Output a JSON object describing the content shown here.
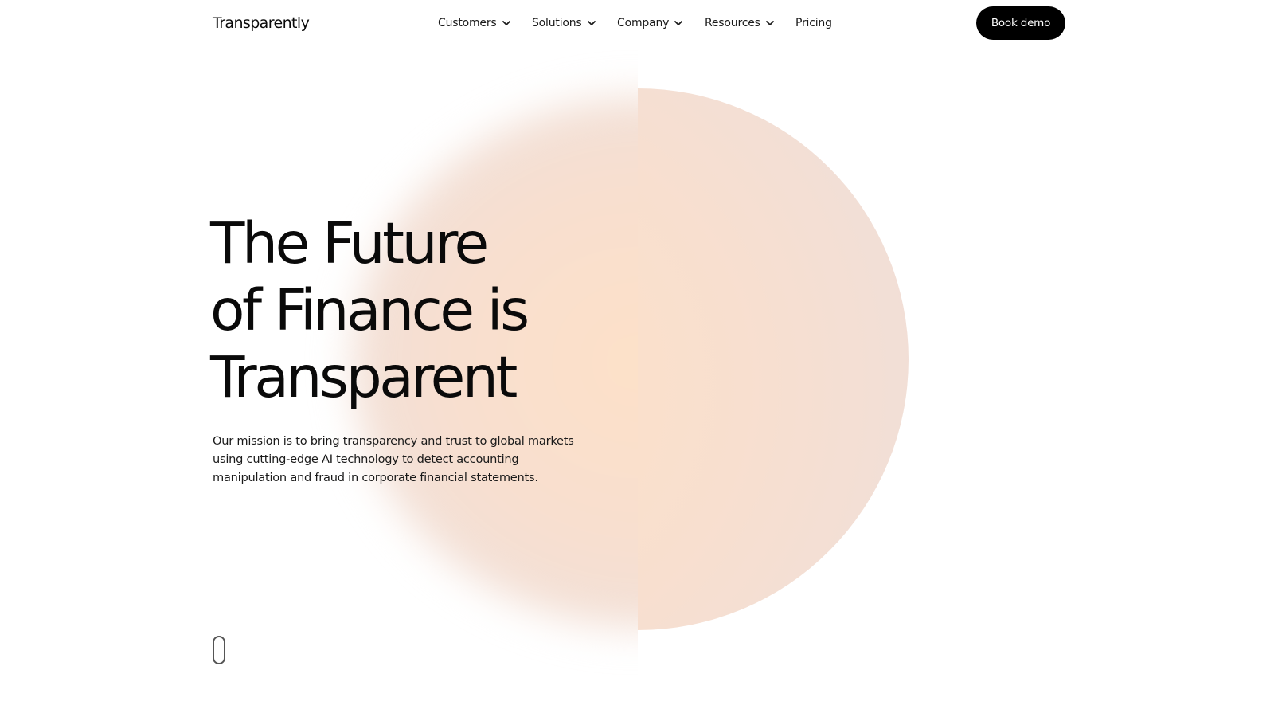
{
  "header": {
    "logo": "Transparently",
    "nav": [
      {
        "label": "Customers",
        "has_dropdown": true,
        "icon": "chevron-down-icon"
      },
      {
        "label": "Solutions",
        "has_dropdown": true,
        "icon": "chevron-down-icon"
      },
      {
        "label": "Company",
        "has_dropdown": true,
        "icon": "chevron-down-icon"
      },
      {
        "label": "Resources",
        "has_dropdown": true,
        "icon": "chevron-down-icon"
      },
      {
        "label": "Pricing",
        "has_dropdown": false
      }
    ],
    "cta_label": "Book demo"
  },
  "hero": {
    "title_lines": [
      "The Future",
      "of Finance is",
      "Transparent"
    ],
    "description": "Our mission is to bring transparency and trust to global markets using cutting-edge AI technology to detect accounting manipulation and fraud in corporate financial statements."
  },
  "scroll_indicator": {
    "icon": "mouse-scroll-icon"
  },
  "colors": {
    "accent_peach": "#fde1c8",
    "accent_pink": "#f2dfd6",
    "cta_background": "#000000",
    "cta_text": "#ffffff",
    "text": "#0a0a0a"
  }
}
